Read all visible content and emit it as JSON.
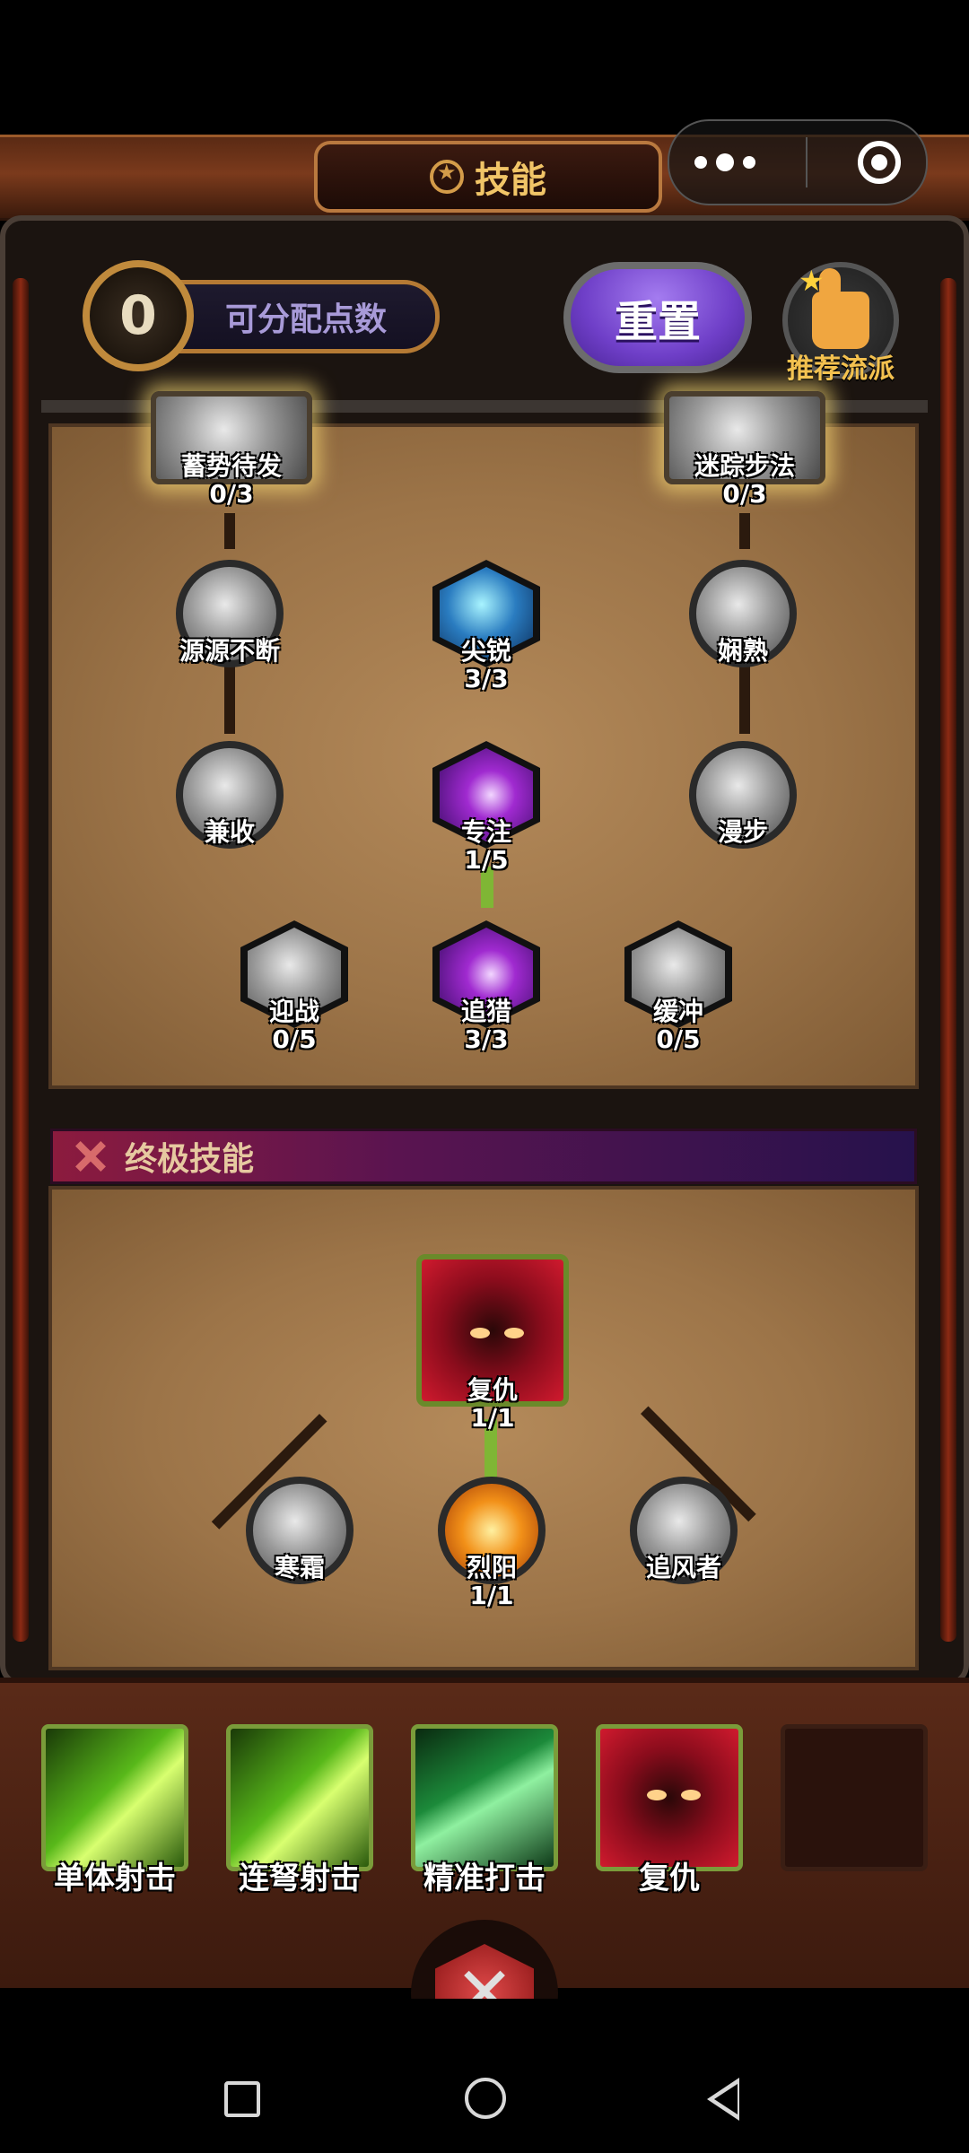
{
  "header": {
    "title": "技能"
  },
  "points": {
    "value": "0",
    "label": "可分配点数"
  },
  "reset_label": "重置",
  "recommend_label": "推荐流派",
  "tree": {
    "row1": [
      {
        "name": "蓄势待发",
        "level": "0/3"
      },
      {
        "name": "迷踪步法",
        "level": "0/3"
      }
    ],
    "row2": [
      {
        "name": "源源不断"
      },
      {
        "name": "尖锐",
        "level": "3/3"
      },
      {
        "name": "娴熟"
      }
    ],
    "row3": [
      {
        "name": "兼收"
      },
      {
        "name": "专注",
        "level": "1/5"
      },
      {
        "name": "漫步"
      }
    ],
    "row4": [
      {
        "name": "迎战",
        "level": "0/5"
      },
      {
        "name": "追猎",
        "level": "3/3"
      },
      {
        "name": "缓冲",
        "level": "0/5"
      }
    ]
  },
  "ultimate": {
    "section_title": "终极技能",
    "main": {
      "name": "复仇",
      "level": "1/1"
    },
    "options": [
      {
        "name": "寒霜"
      },
      {
        "name": "烈阳",
        "level": "1/1"
      },
      {
        "name": "追风者"
      }
    ]
  },
  "equipped": [
    {
      "name": "单体射击"
    },
    {
      "name": "连弩射击"
    },
    {
      "name": "精准打击"
    },
    {
      "name": "复仇"
    }
  ],
  "colors": {
    "accent_gold": "#f1c567",
    "reset_purple": "#6f3fc8",
    "link_green": "#7fb635"
  }
}
